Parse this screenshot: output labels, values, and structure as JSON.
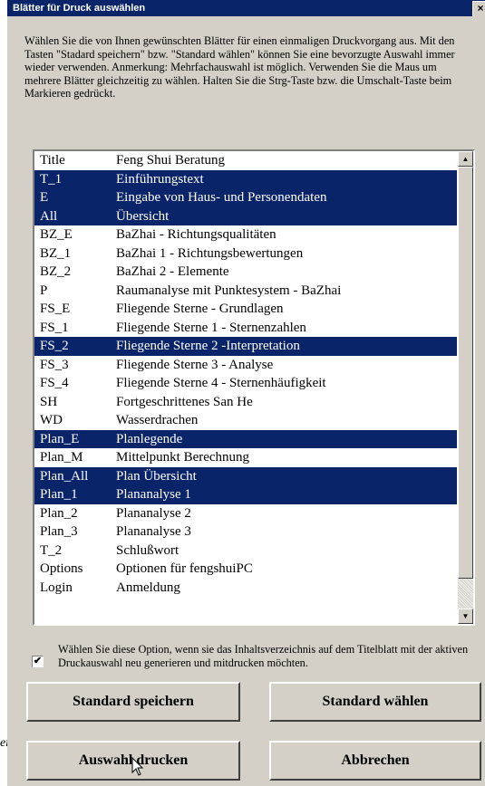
{
  "window": {
    "title": "Blätter für Druck auswählen",
    "close_label": "×"
  },
  "description": "Wählen Sie die von Ihnen gewünschten Blätter für einen einmaligen Druckvorgang aus. Mit den Tasten \"Stadard speichern\" bzw. \"Standard wählen\" können Sie eine bevorzugte Auswahl immer wieder verwenden. Anmerkung: Mehrfachauswahl ist möglich. Verwenden Sie die Maus um mehrere Blätter gleichzeitig zu wählen. Halten Sie die  Strg-Taste bzw. die Umschalt-Taste beim Markieren gedrückt.",
  "sheets": [
    {
      "code": "Title",
      "name": "Feng Shui Beratung",
      "selected": false
    },
    {
      "code": "T_1",
      "name": "Einführungstext",
      "selected": true
    },
    {
      "code": "E",
      "name": "Eingabe von Haus- und Personendaten",
      "selected": true
    },
    {
      "code": "All",
      "name": "Übersicht",
      "selected": true
    },
    {
      "code": "BZ_E",
      "name": "BaZhai - Richtungsqualitäten",
      "selected": false
    },
    {
      "code": "BZ_1",
      "name": "BaZhai 1 - Richtungsbewertungen",
      "selected": false
    },
    {
      "code": "BZ_2",
      "name": "BaZhai 2 - Elemente",
      "selected": false
    },
    {
      "code": "P",
      "name": "Raumanalyse mit Punktesystem - BaZhai",
      "selected": false
    },
    {
      "code": "FS_E",
      "name": "Fliegende Sterne - Grundlagen",
      "selected": false
    },
    {
      "code": "FS_1",
      "name": "Fliegende Sterne 1 - Sternenzahlen",
      "selected": false
    },
    {
      "code": "FS_2",
      "name": "Fliegende Sterne 2 -Interpretation",
      "selected": true
    },
    {
      "code": "FS_3",
      "name": "Fliegende Sterne 3 - Analyse",
      "selected": false
    },
    {
      "code": "FS_4",
      "name": "Fliegende Sterne 4 -  Sternenhäufigkeit",
      "selected": false
    },
    {
      "code": "SH",
      "name": "Fortgeschrittenes San He",
      "selected": false
    },
    {
      "code": "WD",
      "name": "Wasserdrachen",
      "selected": false
    },
    {
      "code": "Plan_E",
      "name": "Planlegende",
      "selected": true
    },
    {
      "code": "Plan_M",
      "name": "Mittelpunkt Berechnung",
      "selected": false
    },
    {
      "code": "Plan_All",
      "name": "Plan Übersicht",
      "selected": true
    },
    {
      "code": "Plan_1",
      "name": "Plananalyse 1",
      "selected": true
    },
    {
      "code": "Plan_2",
      "name": "Plananalyse 2",
      "selected": false
    },
    {
      "code": "Plan_3",
      "name": "Plananalyse 3",
      "selected": false
    },
    {
      "code": "T_2",
      "name": "Schlußwort",
      "selected": false
    },
    {
      "code": "Options",
      "name": "Optionen für fengshuiPC",
      "selected": false
    },
    {
      "code": "Login",
      "name": "Anmeldung",
      "selected": false
    }
  ],
  "scrollbar": {
    "up_glyph": "▲",
    "down_glyph": "▼"
  },
  "option": {
    "checked": true,
    "check_glyph": "✔",
    "text": "Wählen Sie diese Option, wenn sie das Inhaltsverzeichnis auf dem Titelblatt mit der aktiven Druckauswahl neu generieren und mitdrucken möchten."
  },
  "buttons": {
    "save_default": "Standard speichern",
    "choose_default": "Standard wählen",
    "print_selection": "Auswahl drucken",
    "cancel": "Abbrechen"
  },
  "left_edge_text": "er"
}
